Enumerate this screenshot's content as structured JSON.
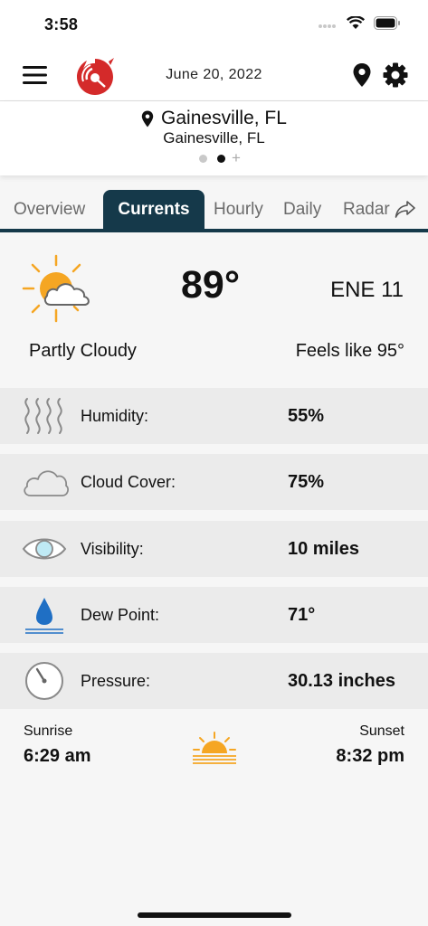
{
  "status_bar": {
    "time": "3:58"
  },
  "header": {
    "date": "June 20, 2022"
  },
  "location": {
    "title": "Gainesville, FL",
    "subtitle": "Gainesville, FL",
    "page_count": 2,
    "active_page": 1
  },
  "tabs": [
    {
      "label": "Overview",
      "active": false
    },
    {
      "label": "Currents",
      "active": true
    },
    {
      "label": "Hourly",
      "active": false
    },
    {
      "label": "Daily",
      "active": false
    },
    {
      "label": "Radar",
      "active": false
    }
  ],
  "current": {
    "temperature": "89°",
    "wind": "ENE 11",
    "condition": "Partly Cloudy",
    "feels_like": "Feels like 95°",
    "icon": "partly-cloudy-icon"
  },
  "details": [
    {
      "label": "Humidity:",
      "value": "55%",
      "icon": "humidity-icon"
    },
    {
      "label": "Cloud Cover:",
      "value": "75%",
      "icon": "cloud-icon"
    },
    {
      "label": "Visibility:",
      "value": "10 miles",
      "icon": "eye-icon"
    },
    {
      "label": "Dew Point:",
      "value": "71°",
      "icon": "dew-drop-icon"
    },
    {
      "label": "Pressure:",
      "value": "30.13 inches",
      "icon": "gauge-icon"
    }
  ],
  "sun": {
    "sunrise_label": "Sunrise",
    "sunrise_time": "6:29 am",
    "sunset_label": "Sunset",
    "sunset_time": "8:32 pm"
  },
  "colors": {
    "accent": "#15394a",
    "sun": "#f5a623",
    "drop": "#1f6fc4",
    "logo": "#d42a2a"
  }
}
